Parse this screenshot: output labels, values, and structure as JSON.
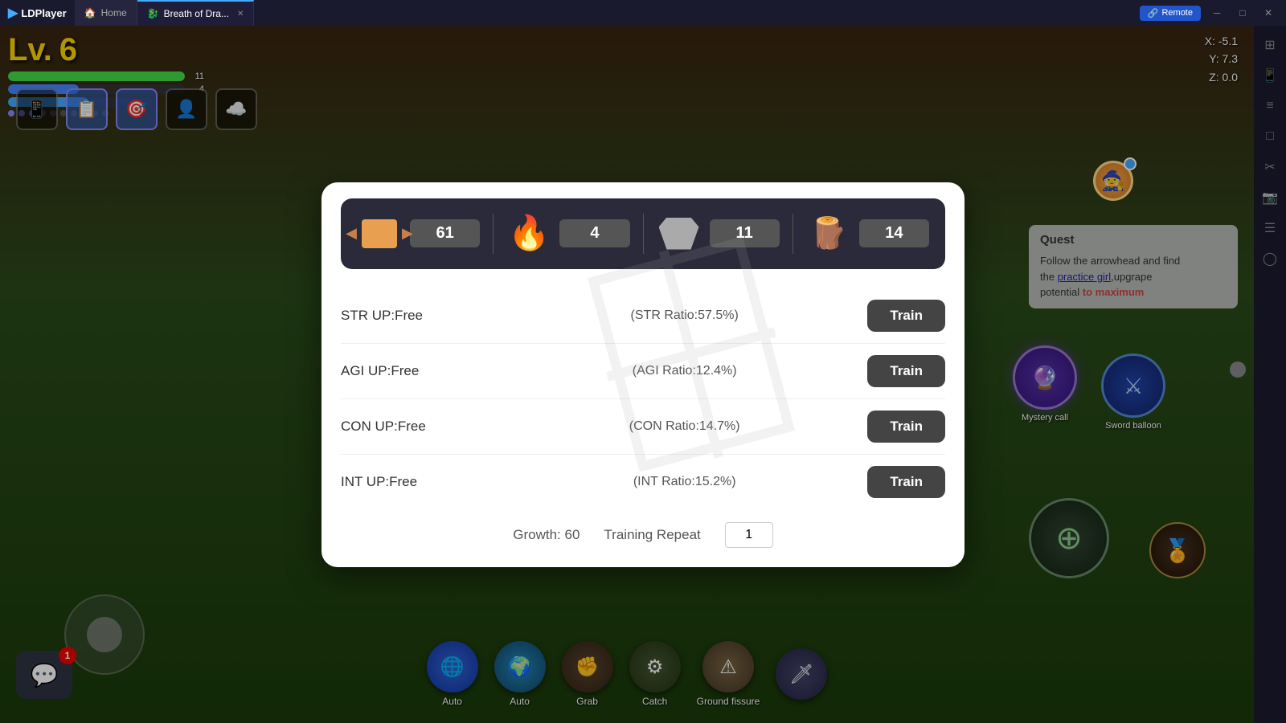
{
  "app": {
    "title": "LDPlayer",
    "tabs": [
      {
        "id": "home",
        "label": "Home",
        "icon": "🏠",
        "active": false
      },
      {
        "id": "game",
        "label": "Breath of Dra...",
        "icon": "🐉",
        "active": true,
        "closeable": true
      }
    ],
    "remote_label": "Remote",
    "window_controls": [
      "minimize",
      "maximize",
      "close"
    ]
  },
  "hud": {
    "level": "Lv.",
    "level_num": "6",
    "hp_current": "11",
    "hp_max": "11",
    "hp_percent": 100,
    "mp_current": "4",
    "mp_percent": 40,
    "xp_percent": 55,
    "coords": {
      "x": "X: -5.1",
      "y": "Y: 7.3",
      "z": "Z: 0.0"
    }
  },
  "icons": {
    "mobile": "📱",
    "document": "📋",
    "crosshair": "🎯",
    "person": "👤",
    "cloud": "☁️"
  },
  "quest": {
    "title": "Quest",
    "text1": "ollow the arrowhead and find",
    "text2": "the practice girl,upgrape",
    "text3": "otential to maximum",
    "highlight": "practice girl",
    "highlight2": "to maximum"
  },
  "dialog": {
    "resources": [
      {
        "id": "wood",
        "value": "61"
      },
      {
        "id": "flame",
        "value": "4"
      },
      {
        "id": "stone",
        "value": "11"
      },
      {
        "id": "log",
        "value": "14"
      }
    ],
    "stats": [
      {
        "id": "str",
        "label": "STR UP:Free",
        "ratio": "(STR Ratio:57.5%)",
        "button": "Train"
      },
      {
        "id": "agi",
        "label": "AGI UP:Free",
        "ratio": "(AGI Ratio:12.4%)",
        "button": "Train"
      },
      {
        "id": "con",
        "label": "CON UP:Free",
        "ratio": "(CON Ratio:14.7%)",
        "button": "Train"
      },
      {
        "id": "int",
        "label": "INT UP:Free",
        "ratio": "(INT Ratio:15.2%)",
        "button": "Train"
      }
    ],
    "growth_label": "Growth:",
    "growth_value": "60",
    "repeat_label": "Training Repeat",
    "repeat_value": "1"
  },
  "bottom_toolbar": [
    {
      "id": "auto1",
      "label": "Auto",
      "color": "#2255aa"
    },
    {
      "id": "auto2",
      "label": "Auto",
      "color": "#2288aa"
    },
    {
      "id": "grab",
      "label": "Grab",
      "color": "#443322"
    },
    {
      "id": "catch",
      "label": "Catch",
      "color": "#334422"
    },
    {
      "id": "ground_fissure",
      "label": "Ground fissure",
      "color": "#664422"
    },
    {
      "id": "skill",
      "label": "",
      "color": "#333355"
    }
  ],
  "right_sidebar_icons": [
    "⊞",
    "📱",
    "≡",
    "□",
    "✂",
    "📷",
    "☰",
    "◯"
  ],
  "mystery_call_label": "Mystery call",
  "sword_balloon_label": "Sword balloon",
  "chat_badge": "1"
}
